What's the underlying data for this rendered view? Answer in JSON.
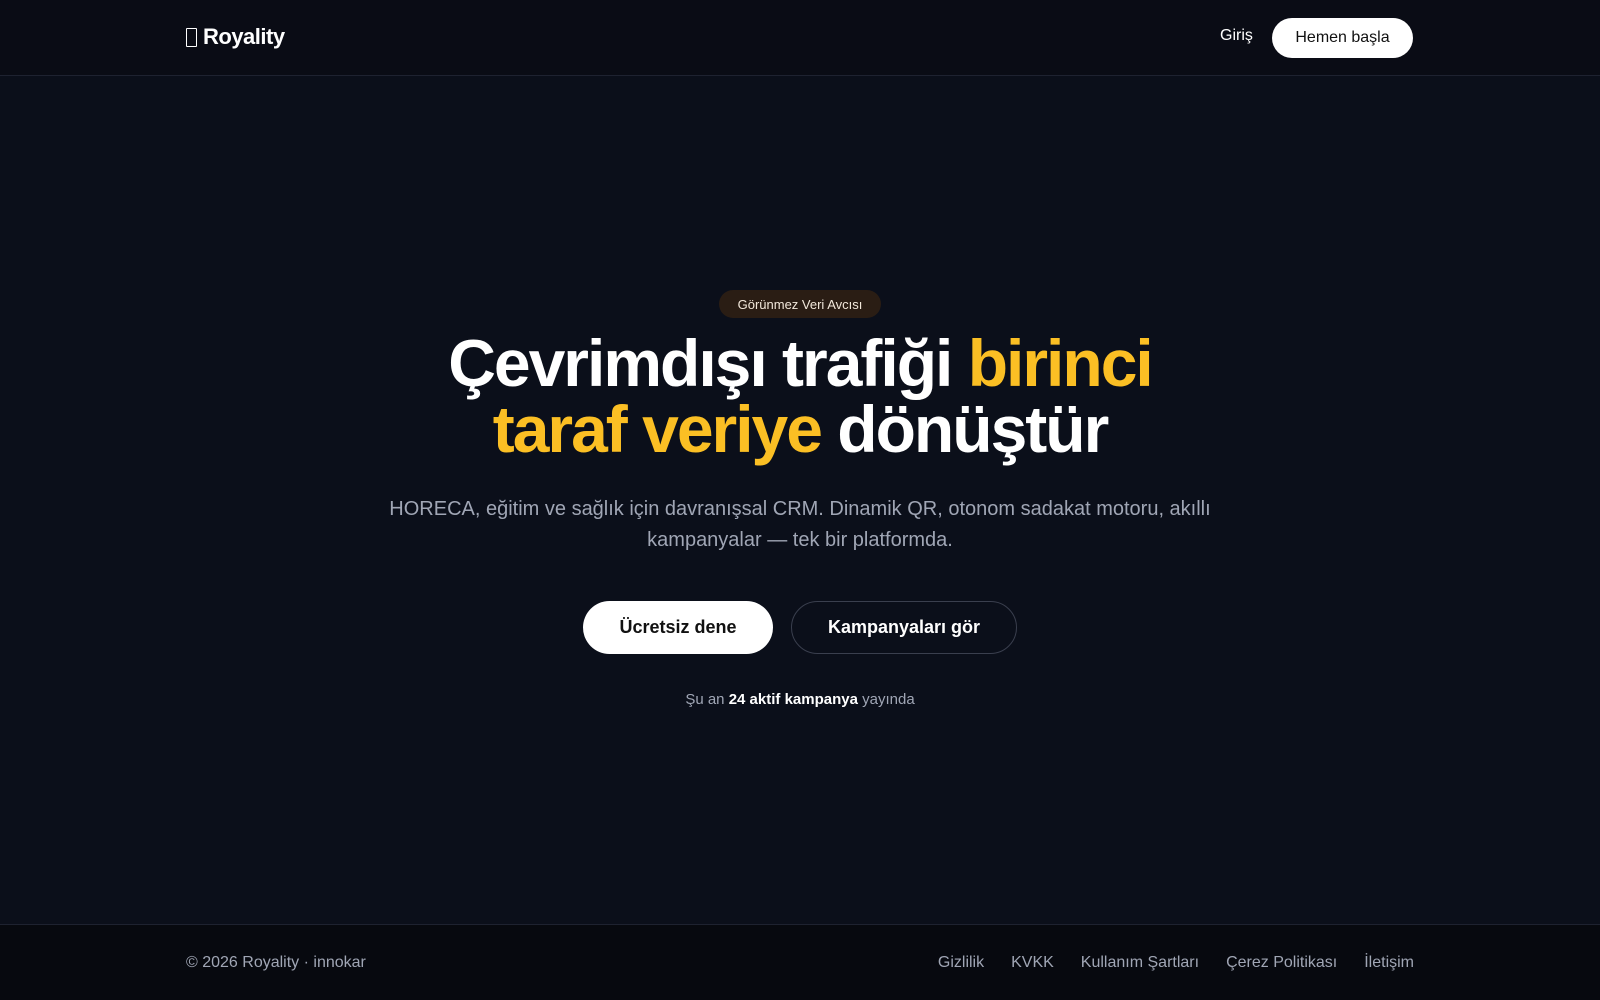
{
  "header": {
    "brand": "Royality",
    "login_label": "Giriş",
    "start_label": "Hemen başla"
  },
  "hero": {
    "badge": "Görünmez Veri Avcısı",
    "headline": {
      "part1": "Çevrimdışı trafiği ",
      "highlight1": "birinci",
      "highlight2": "taraf veriye",
      "part2": " dönüştür"
    },
    "subtitle": "HORECA, eğitim ve sağlık için davranışsal CRM. Dinamik QR, otonom sadakat motoru, akıllı kampanyalar — tek bir platformda.",
    "primary_cta": "Ücretsiz dene",
    "secondary_cta": "Kampanyaları gör",
    "status": {
      "prefix": "Şu an ",
      "highlight": "24 aktif kampanya",
      "suffix": " yayında"
    }
  },
  "footer": {
    "copyright": "© 2026 Royality · innokar",
    "links": [
      "Gizlilik",
      "KVKK",
      "Kullanım Şartları",
      "Çerez Politikası",
      "İletişim"
    ]
  },
  "colors": {
    "background": "#0b0f1a",
    "accent": "#fbbf24",
    "badge_bg": "#2a1d14"
  }
}
